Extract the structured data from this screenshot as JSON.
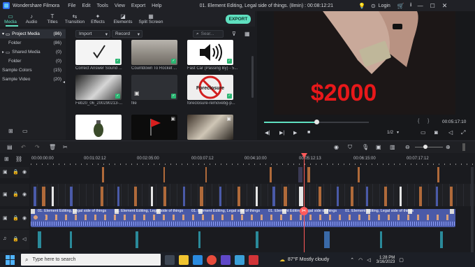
{
  "titlebar": {
    "app_name": "Wondershare Filmora",
    "menus": [
      "File",
      "Edit",
      "Tools",
      "View",
      "Export",
      "Help"
    ],
    "project_title": "01. Element Editing, Legal side of things. (8min) : 00:08:12:21",
    "login_label": "Login"
  },
  "toolbar": {
    "tabs": [
      {
        "label": "Media",
        "icon": "folder-icon",
        "active": true
      },
      {
        "label": "Audio",
        "icon": "music-note-icon",
        "active": false
      },
      {
        "label": "Titles",
        "icon": "text-icon",
        "active": false
      },
      {
        "label": "Transition",
        "icon": "transition-icon",
        "active": false
      },
      {
        "label": "Effects",
        "icon": "effects-icon",
        "active": false
      },
      {
        "label": "Elements",
        "icon": "elements-icon",
        "active": false
      },
      {
        "label": "Split Screen",
        "icon": "split-screen-icon",
        "active": false
      }
    ],
    "export_label": "EXPORT"
  },
  "sidebar": {
    "items": [
      {
        "label": "Project Media",
        "count": "(86)"
      },
      {
        "label": "Folder",
        "count": "(86)"
      },
      {
        "label": "Shared Media",
        "count": "(0)"
      },
      {
        "label": "Folder",
        "count": "(0)"
      },
      {
        "label": "Sample Colors",
        "count": "(15)"
      },
      {
        "label": "Sample Video",
        "count": "(20)"
      }
    ]
  },
  "media": {
    "import_label": "Import",
    "record_label": "Record",
    "search_placeholder": "Sear...",
    "items": [
      {
        "label": "Correct Answer Sound ..."
      },
      {
        "label": "Countdown To Rocket ..."
      },
      {
        "label": "Fast Car (Passing By) - 5..."
      },
      {
        "label": "Feb20_06_200290213-..."
      },
      {
        "label": "file"
      },
      {
        "label": "foreclosure-removebg-p..."
      },
      {
        "label": ""
      },
      {
        "label": ""
      },
      {
        "label": ""
      }
    ],
    "foreclosure_text": "Foreclosure"
  },
  "preview": {
    "overlay_text": "$2000",
    "timecode": "00:05:17:10",
    "ratio": "1/2",
    "progress": 0.5
  },
  "ruler": {
    "labels": [
      "00:00:00:00",
      "00:01:02:12",
      "00:02:05:00",
      "00:03:07:12",
      "00:04:10:00",
      "00:05:12:13",
      "00:06:15:00",
      "00:07:17:12"
    ]
  },
  "clip": {
    "label": "01. Element Editing, Legal side of things"
  },
  "taskbar": {
    "search_placeholder": "Type here to search",
    "weather": "87°F  Mostly cloudy",
    "time": "1:28 PM",
    "date": "3/16/2023"
  },
  "colors": {
    "accent": "#5fe0c0",
    "playhead": "#ff5a5a",
    "clip": "#4a5aa8"
  }
}
